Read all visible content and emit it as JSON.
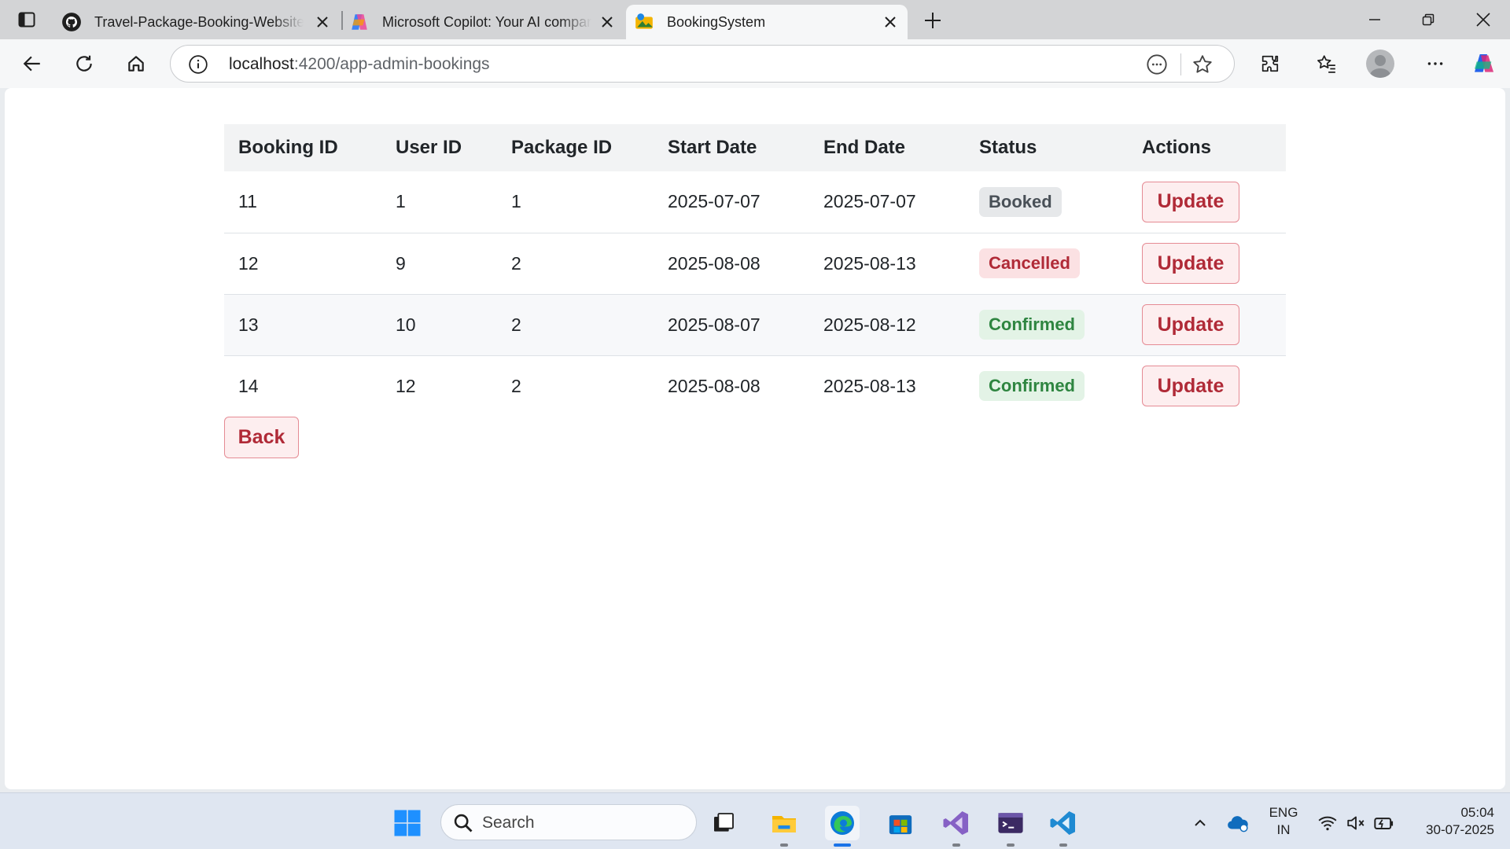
{
  "browser": {
    "tabs": [
      {
        "title": "Travel-Package-Booking-Website",
        "favicon": "github-icon",
        "active": false
      },
      {
        "title": "Microsoft Copilot: Your AI companion",
        "favicon": "copilot-icon",
        "active": false
      },
      {
        "title": "BookingSystem",
        "favicon": "booking-app-icon",
        "active": true
      }
    ],
    "address": {
      "host": "localhost",
      "rest": ":4200/app-admin-bookings"
    }
  },
  "bookings": {
    "columns": [
      "Booking ID",
      "User ID",
      "Package ID",
      "Start Date",
      "End Date",
      "Status",
      "Actions"
    ],
    "rows": [
      {
        "booking_id": "11",
        "user_id": "1",
        "package_id": "1",
        "start_date": "2025-07-07",
        "end_date": "2025-07-07",
        "status": "Booked",
        "action_label": "Update"
      },
      {
        "booking_id": "12",
        "user_id": "9",
        "package_id": "2",
        "start_date": "2025-08-08",
        "end_date": "2025-08-13",
        "status": "Cancelled",
        "action_label": "Update"
      },
      {
        "booking_id": "13",
        "user_id": "10",
        "package_id": "2",
        "start_date": "2025-08-07",
        "end_date": "2025-08-12",
        "status": "Confirmed",
        "action_label": "Update"
      },
      {
        "booking_id": "14",
        "user_id": "12",
        "package_id": "2",
        "start_date": "2025-08-08",
        "end_date": "2025-08-13",
        "status": "Confirmed",
        "action_label": "Update"
      }
    ],
    "back_label": "Back"
  },
  "status_colors": {
    "Booked": "#495057",
    "Cancelled": "#b02a37",
    "Confirmed": "#2e8540"
  },
  "taskbar": {
    "search_placeholder": "Search",
    "language": "ENG",
    "region": "IN",
    "time": "05:04",
    "date": "30-07-2025"
  }
}
